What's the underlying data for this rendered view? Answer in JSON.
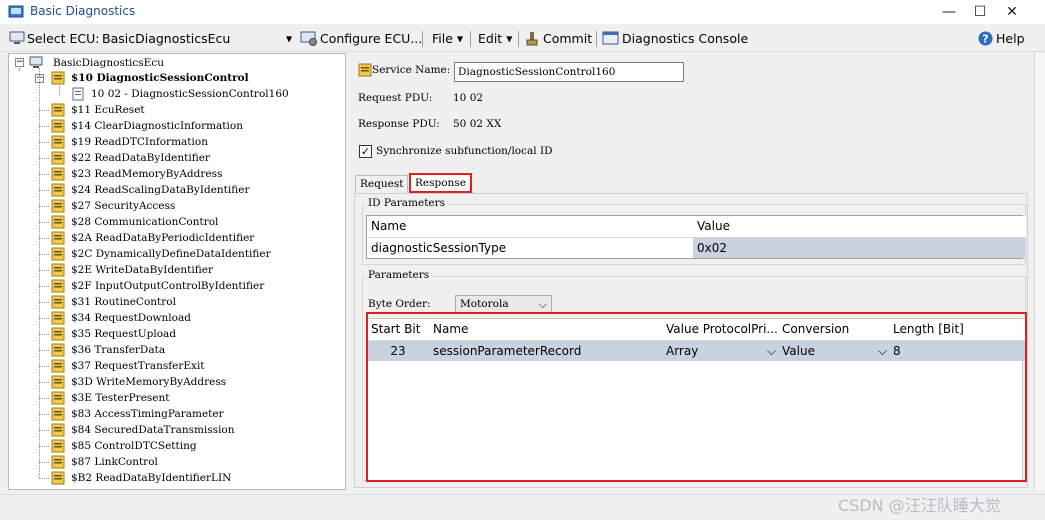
{
  "window": {
    "title": "Basic Diagnostics",
    "minimize": "—",
    "maximize": "☐",
    "close": "✕"
  },
  "toolbar": {
    "select_ecu_label": "Select ECU:",
    "ecu_value": "BasicDiagnosticsEcu",
    "configure": "Configure ECU...",
    "file": "File",
    "edit": "Edit",
    "commit": "Commit",
    "console": "Diagnostics Console",
    "help": "Help"
  },
  "tree": {
    "root": "BasicDiagnosticsEcu",
    "selected": "$10 DiagnosticSessionControl",
    "child": "10 02 - DiagnosticSessionControl160",
    "services": [
      "$11 EcuReset",
      "$14 ClearDiagnosticInformation",
      "$19 ReadDTCInformation",
      "$22 ReadDataByIdentifier",
      "$23 ReadMemoryByAddress",
      "$24 ReadScalingDataByIdentifier",
      "$27 SecurityAccess",
      "$28 CommunicationControl",
      "$2A ReadDataByPeriodicIdentifier",
      "$2C DynamicallyDefineDataIdentifier",
      "$2E WriteDataByIdentifier",
      "$2F InputOutputControlByIdentifier",
      "$31 RoutineControl",
      "$34 RequestDownload",
      "$35 RequestUpload",
      "$36 TransferData",
      "$37 RequestTransferExit",
      "$3D WriteMemoryByAddress",
      "$3E TesterPresent",
      "$83 AccessTimingParameter",
      "$84 SecuredDataTransmission",
      "$85 ControlDTCSetting",
      "$87 LinkControl",
      "$B2 ReadDataByIdentifierLIN"
    ]
  },
  "details": {
    "service_name_label": "Service Name:",
    "service_name_value": "DiagnosticSessionControl160",
    "request_pdu_label": "Request PDU:",
    "request_pdu_value": "10 02",
    "response_pdu_label": "Response PDU:",
    "response_pdu_value": "50 02 XX",
    "sync_label": "Synchronize subfunction/local ID",
    "sync_checked": "✓",
    "tabs": [
      "Request",
      "Response"
    ],
    "id_params_title": "ID Parameters",
    "id_grid": {
      "headers": [
        "Name",
        "Value"
      ],
      "row": [
        "diagnosticSessionType",
        "0x02"
      ]
    },
    "params_title": "Parameters",
    "byte_order_label": "Byte Order:",
    "byte_order_value": "Motorola",
    "param_grid": {
      "headers": [
        "Start Bit",
        "Name",
        "Value ProtocolPri...",
        "Conversion",
        "Length [Bit]"
      ],
      "row": [
        "23",
        "sessionParameterRecord",
        "Array",
        "Value",
        "8"
      ]
    }
  },
  "watermark": "CSDN @汪汪队睡大觉",
  "colors": {
    "selection": "#c9d3e0",
    "highlight_box": "#e02020",
    "title_text": "#1f4f8f"
  }
}
